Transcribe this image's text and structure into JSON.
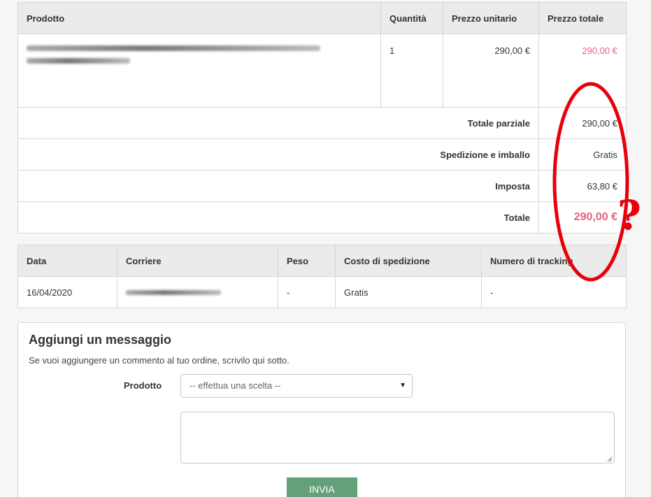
{
  "order_table": {
    "headers": {
      "product": "Prodotto",
      "quantity": "Quantità",
      "unit_price": "Prezzo unitario",
      "total_price": "Prezzo totale"
    },
    "item": {
      "quantity": "1",
      "unit_price": "290,00 €",
      "total_price": "290,00 €"
    },
    "summary": {
      "subtotal_label": "Totale parziale",
      "subtotal_value": "290,00 €",
      "shipping_label": "Spedizione e imballo",
      "shipping_value": "Gratis",
      "tax_label": "Imposta",
      "tax_value": "63,80 €",
      "total_label": "Totale",
      "total_value": "290,00 €"
    }
  },
  "shipping_table": {
    "headers": {
      "date": "Data",
      "carrier": "Corriere",
      "weight": "Peso",
      "cost": "Costo di spedizione",
      "tracking": "Numero di tracking"
    },
    "row": {
      "date": "16/04/2020",
      "weight": "-",
      "cost": "Gratis",
      "tracking": "-"
    }
  },
  "message_form": {
    "title": "Aggiungi un messaggio",
    "description": "Se vuoi aggiungere un commento al tuo ordine, scrivilo qui sotto.",
    "product_label": "Prodotto",
    "product_select_value": "-- effettua una scelta --",
    "send_label": "INVIA"
  },
  "annotation": {
    "mark": "?",
    "color": "#e8000a"
  },
  "colors": {
    "price_accent": "#e8607f",
    "button": "#64a07a",
    "header_bg": "#ebebeb"
  }
}
